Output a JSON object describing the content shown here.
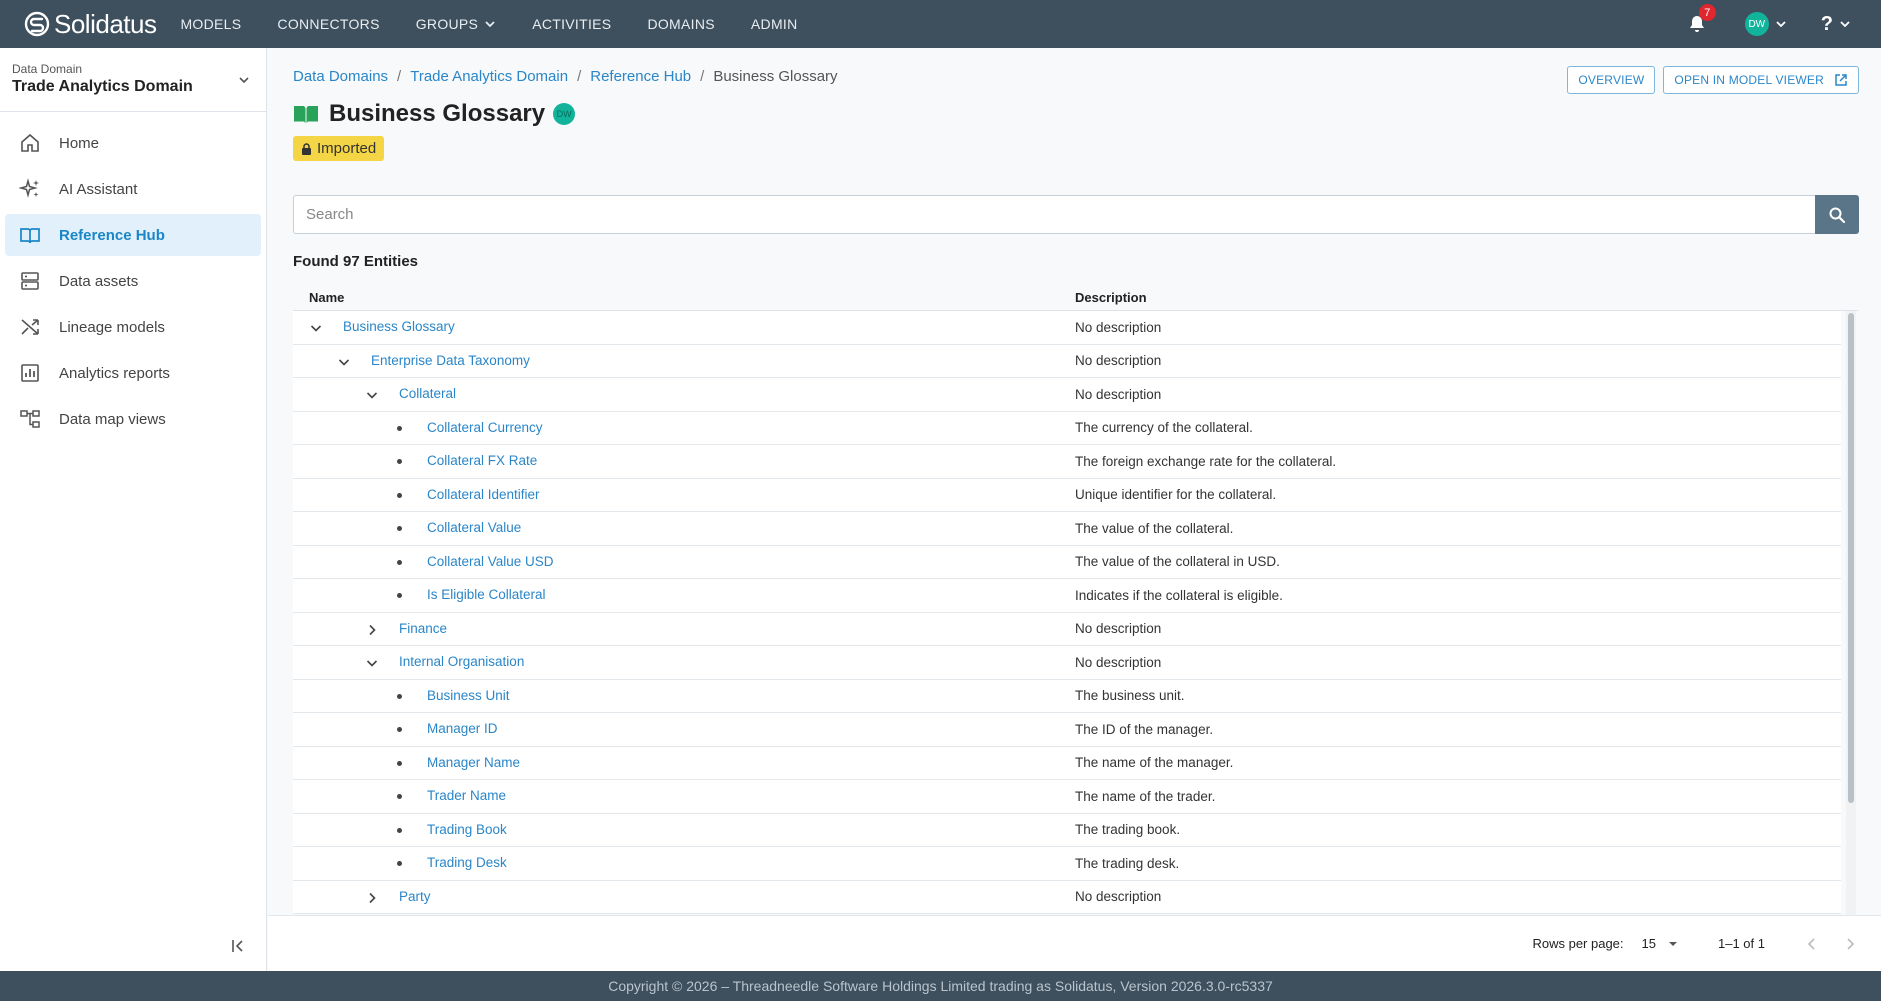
{
  "app": {
    "logo_text": "Solidatus",
    "nav": [
      {
        "label": "MODELS"
      },
      {
        "label": "CONNECTORS"
      },
      {
        "label": "GROUPS"
      },
      {
        "label": "ACTIVITIES"
      },
      {
        "label": "DOMAINS"
      },
      {
        "label": "ADMIN"
      }
    ],
    "notifications_count": "7",
    "user_initials": "DW",
    "help_label": "?"
  },
  "sidebar": {
    "domain_label": "Data Domain",
    "domain_value": "Trade Analytics Domain",
    "items": [
      {
        "label": "Home",
        "icon": "home-icon"
      },
      {
        "label": "AI Assistant",
        "icon": "sparkle-icon"
      },
      {
        "label": "Reference Hub",
        "icon": "book-icon",
        "active": true
      },
      {
        "label": "Data assets",
        "icon": "storage-icon"
      },
      {
        "label": "Lineage models",
        "icon": "shuffle-icon"
      },
      {
        "label": "Analytics reports",
        "icon": "chart-icon"
      },
      {
        "label": "Data map views",
        "icon": "hierarchy-icon"
      }
    ]
  },
  "breadcrumb": [
    {
      "label": "Data Domains"
    },
    {
      "label": "Trade Analytics Domain"
    },
    {
      "label": "Reference Hub"
    },
    {
      "label": "Business Glossary"
    }
  ],
  "buttons": {
    "overview": "OVERVIEW",
    "open_model_viewer": "OPEN IN MODEL VIEWER"
  },
  "page": {
    "title": "Business Glossary",
    "owner_initials": "DW",
    "status_badge": "Imported",
    "search_placeholder": "Search",
    "found_text": "Found 97 Entities"
  },
  "table": {
    "columns": {
      "name": "Name",
      "description": "Description"
    },
    "rows": [
      {
        "name": "Business Glossary",
        "description": "No description",
        "level": 0,
        "kind": "expanded"
      },
      {
        "name": "Enterprise Data Taxonomy",
        "description": "No description",
        "level": 1,
        "kind": "expanded"
      },
      {
        "name": "Collateral",
        "description": "No description",
        "level": 2,
        "kind": "expanded"
      },
      {
        "name": "Collateral Currency",
        "description": "The currency of the collateral.",
        "level": 3,
        "kind": "leaf"
      },
      {
        "name": "Collateral FX Rate",
        "description": "The foreign exchange rate for the collateral.",
        "level": 3,
        "kind": "leaf"
      },
      {
        "name": "Collateral Identifier",
        "description": "Unique identifier for the collateral.",
        "level": 3,
        "kind": "leaf"
      },
      {
        "name": "Collateral Value",
        "description": "The value of the collateral.",
        "level": 3,
        "kind": "leaf"
      },
      {
        "name": "Collateral Value USD",
        "description": "The value of the collateral in USD.",
        "level": 3,
        "kind": "leaf"
      },
      {
        "name": "Is Eligible Collateral",
        "description": "Indicates if the collateral is eligible.",
        "level": 3,
        "kind": "leaf"
      },
      {
        "name": "Finance",
        "description": "No description",
        "level": 2,
        "kind": "collapsed"
      },
      {
        "name": "Internal Organisation",
        "description": "No description",
        "level": 2,
        "kind": "expanded"
      },
      {
        "name": "Business Unit",
        "description": "The business unit.",
        "level": 3,
        "kind": "leaf"
      },
      {
        "name": "Manager ID",
        "description": "The ID of the manager.",
        "level": 3,
        "kind": "leaf"
      },
      {
        "name": "Manager Name",
        "description": "The name of the manager.",
        "level": 3,
        "kind": "leaf"
      },
      {
        "name": "Trader Name",
        "description": "The name of the trader.",
        "level": 3,
        "kind": "leaf"
      },
      {
        "name": "Trading Book",
        "description": "The trading book.",
        "level": 3,
        "kind": "leaf"
      },
      {
        "name": "Trading Desk",
        "description": "The trading desk.",
        "level": 3,
        "kind": "leaf"
      },
      {
        "name": "Party",
        "description": "No description",
        "level": 2,
        "kind": "collapsed"
      }
    ]
  },
  "pagination": {
    "rows_per_page_label": "Rows per page:",
    "rows_per_page_value": "15",
    "range": "1–1 of 1"
  },
  "footer": {
    "text": "Copyright © 2026 – Threadneedle Software Holdings Limited trading as Solidatus, Version 2026.3.0-rc5337"
  },
  "colors": {
    "topbar": "#3e4f5d",
    "accent": "#2a86c8",
    "badge": "#f4d545",
    "avatar": "#11b39a"
  }
}
